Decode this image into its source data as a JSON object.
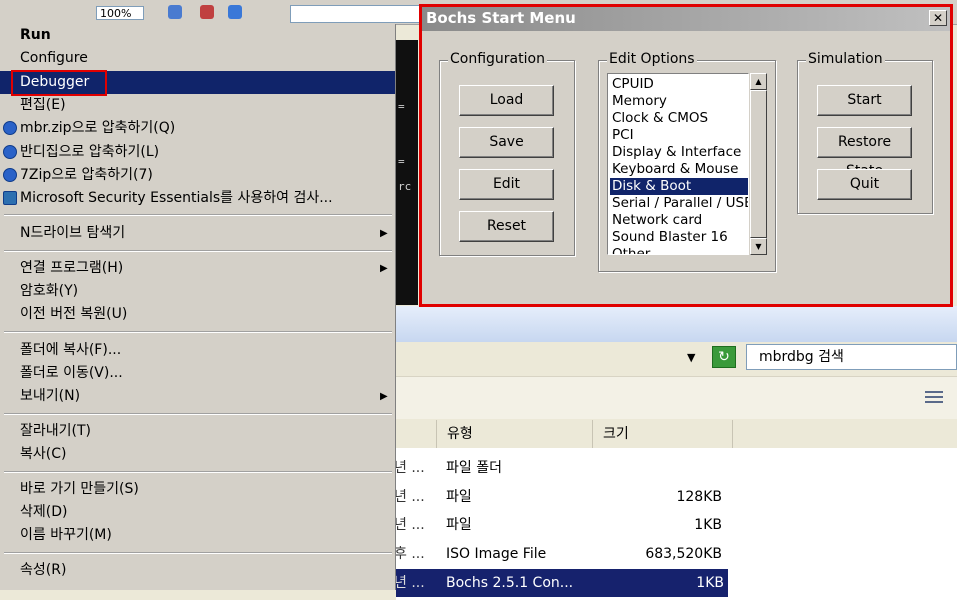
{
  "explorer": {
    "zoom": "100%",
    "search_text": "mbrdbg 검색",
    "columns": [
      "유형",
      "크기"
    ],
    "rows": [
      {
        "name_fragment": "년 ...",
        "type": "파일 폴더",
        "size": ""
      },
      {
        "name_fragment": "년 ...",
        "type": "파일",
        "size": "128KB"
      },
      {
        "name_fragment": "년 ...",
        "type": "파일",
        "size": "1KB"
      },
      {
        "name_fragment": "후 ...",
        "type": "ISO Image File",
        "size": "683,520KB"
      },
      {
        "name_fragment": "년 ...",
        "type": "Bochs 2.5.1 Con...",
        "size": "1KB"
      }
    ]
  },
  "context_menu": {
    "items": [
      {
        "label": "Run",
        "bold": true
      },
      {
        "label": "Configure"
      },
      {
        "label": "Debugger",
        "highlighted": true
      },
      {
        "label": "편집(E)"
      },
      {
        "label": "mbr.zip으로 압축하기(Q)",
        "icon": "zip-icon"
      },
      {
        "label": "반디집으로 압축하기(L)",
        "icon": "zip-icon"
      },
      {
        "label": "7Zip으로 압축하기(7)",
        "icon": "zip-icon"
      },
      {
        "label": "Microsoft Security Essentials를 사용하여 검사...",
        "icon": "shield-icon"
      },
      {
        "label": "N드라이브 탐색기",
        "submenu": true
      },
      {
        "label": "연결 프로그램(H)",
        "submenu": true
      },
      {
        "label": "암호화(Y)"
      },
      {
        "label": "이전 버전 복원(U)"
      },
      {
        "label": "폴더에 복사(F)..."
      },
      {
        "label": "폴더로 이동(V)..."
      },
      {
        "label": "보내기(N)",
        "submenu": true
      },
      {
        "label": "잘라내기(T)"
      },
      {
        "label": "복사(C)"
      },
      {
        "label": "바로 가기 만들기(S)"
      },
      {
        "label": "삭제(D)"
      },
      {
        "label": "이름 바꾸기(M)"
      },
      {
        "label": "속성(R)"
      }
    ]
  },
  "bochs": {
    "title": "Bochs Start Menu",
    "close_glyph": "✕",
    "configuration": {
      "legend": "Configuration",
      "buttons": [
        "Load",
        "Save",
        "Edit",
        "Reset"
      ]
    },
    "edit_options": {
      "legend": "Edit Options",
      "options": [
        "CPUID",
        "Memory",
        "Clock & CMOS",
        "PCI",
        "Display & Interface",
        "Keyboard & Mouse",
        "Disk & Boot",
        "Serial / Parallel / USB",
        "Network card",
        "Sound Blaster 16",
        "Other"
      ],
      "selected": "Disk & Boot"
    },
    "simulation": {
      "legend": "Simulation",
      "buttons": [
        "Start",
        "Restore State",
        "Quit"
      ]
    }
  },
  "colors": {
    "highlight": "#10246a",
    "annotation": "#e00000",
    "dialog_bg": "#d4d0c8"
  }
}
